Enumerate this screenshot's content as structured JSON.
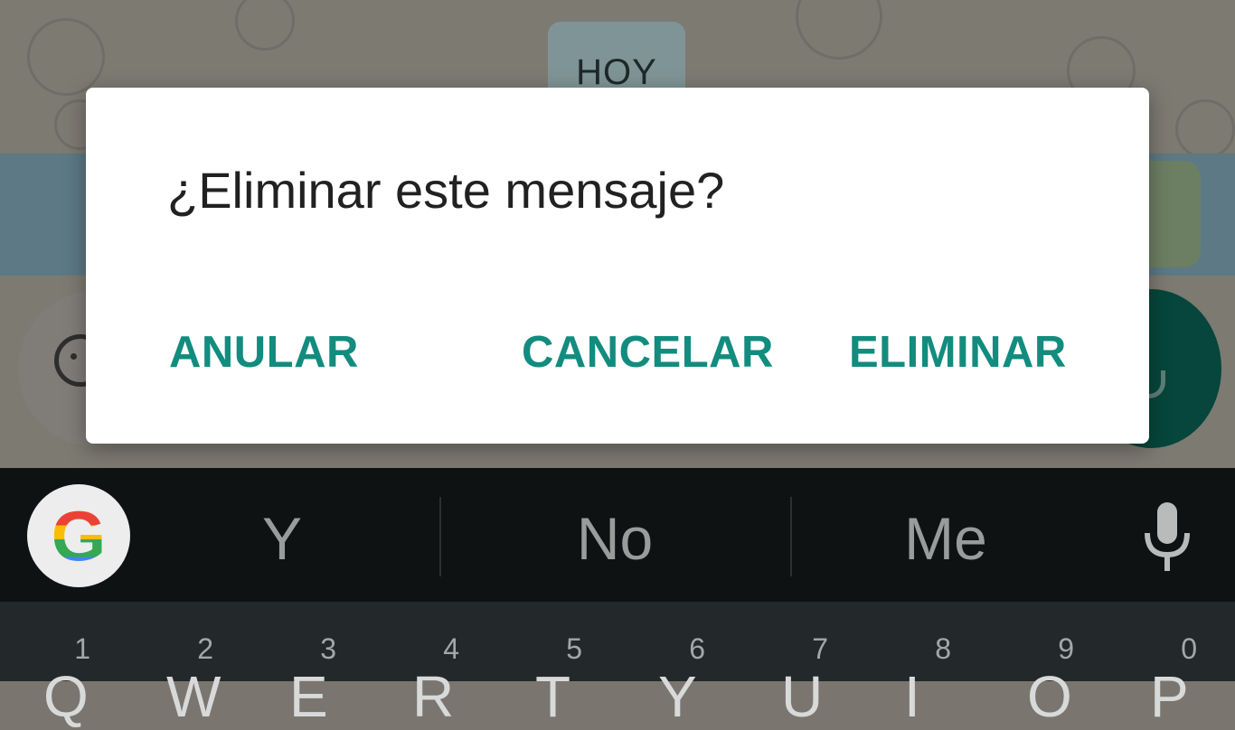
{
  "chat": {
    "date_chip": "HOY"
  },
  "dialog": {
    "title": "¿Eliminar este mensaje?",
    "buttons": {
      "undo": "ANULAR",
      "cancel": "CANCELAR",
      "delete": "ELIMINAR"
    },
    "accent_color": "#128c7e"
  },
  "keyboard": {
    "suggestions": [
      "Y",
      "No",
      "Me"
    ],
    "number_row": [
      "1",
      "2",
      "3",
      "4",
      "5",
      "6",
      "7",
      "8",
      "9",
      "0"
    ],
    "letter_row": [
      "Q",
      "W",
      "E",
      "R",
      "T",
      "Y",
      "U",
      "I",
      "O",
      "P"
    ],
    "icons": {
      "logo": "google-g-icon",
      "voice": "microphone-icon"
    }
  }
}
